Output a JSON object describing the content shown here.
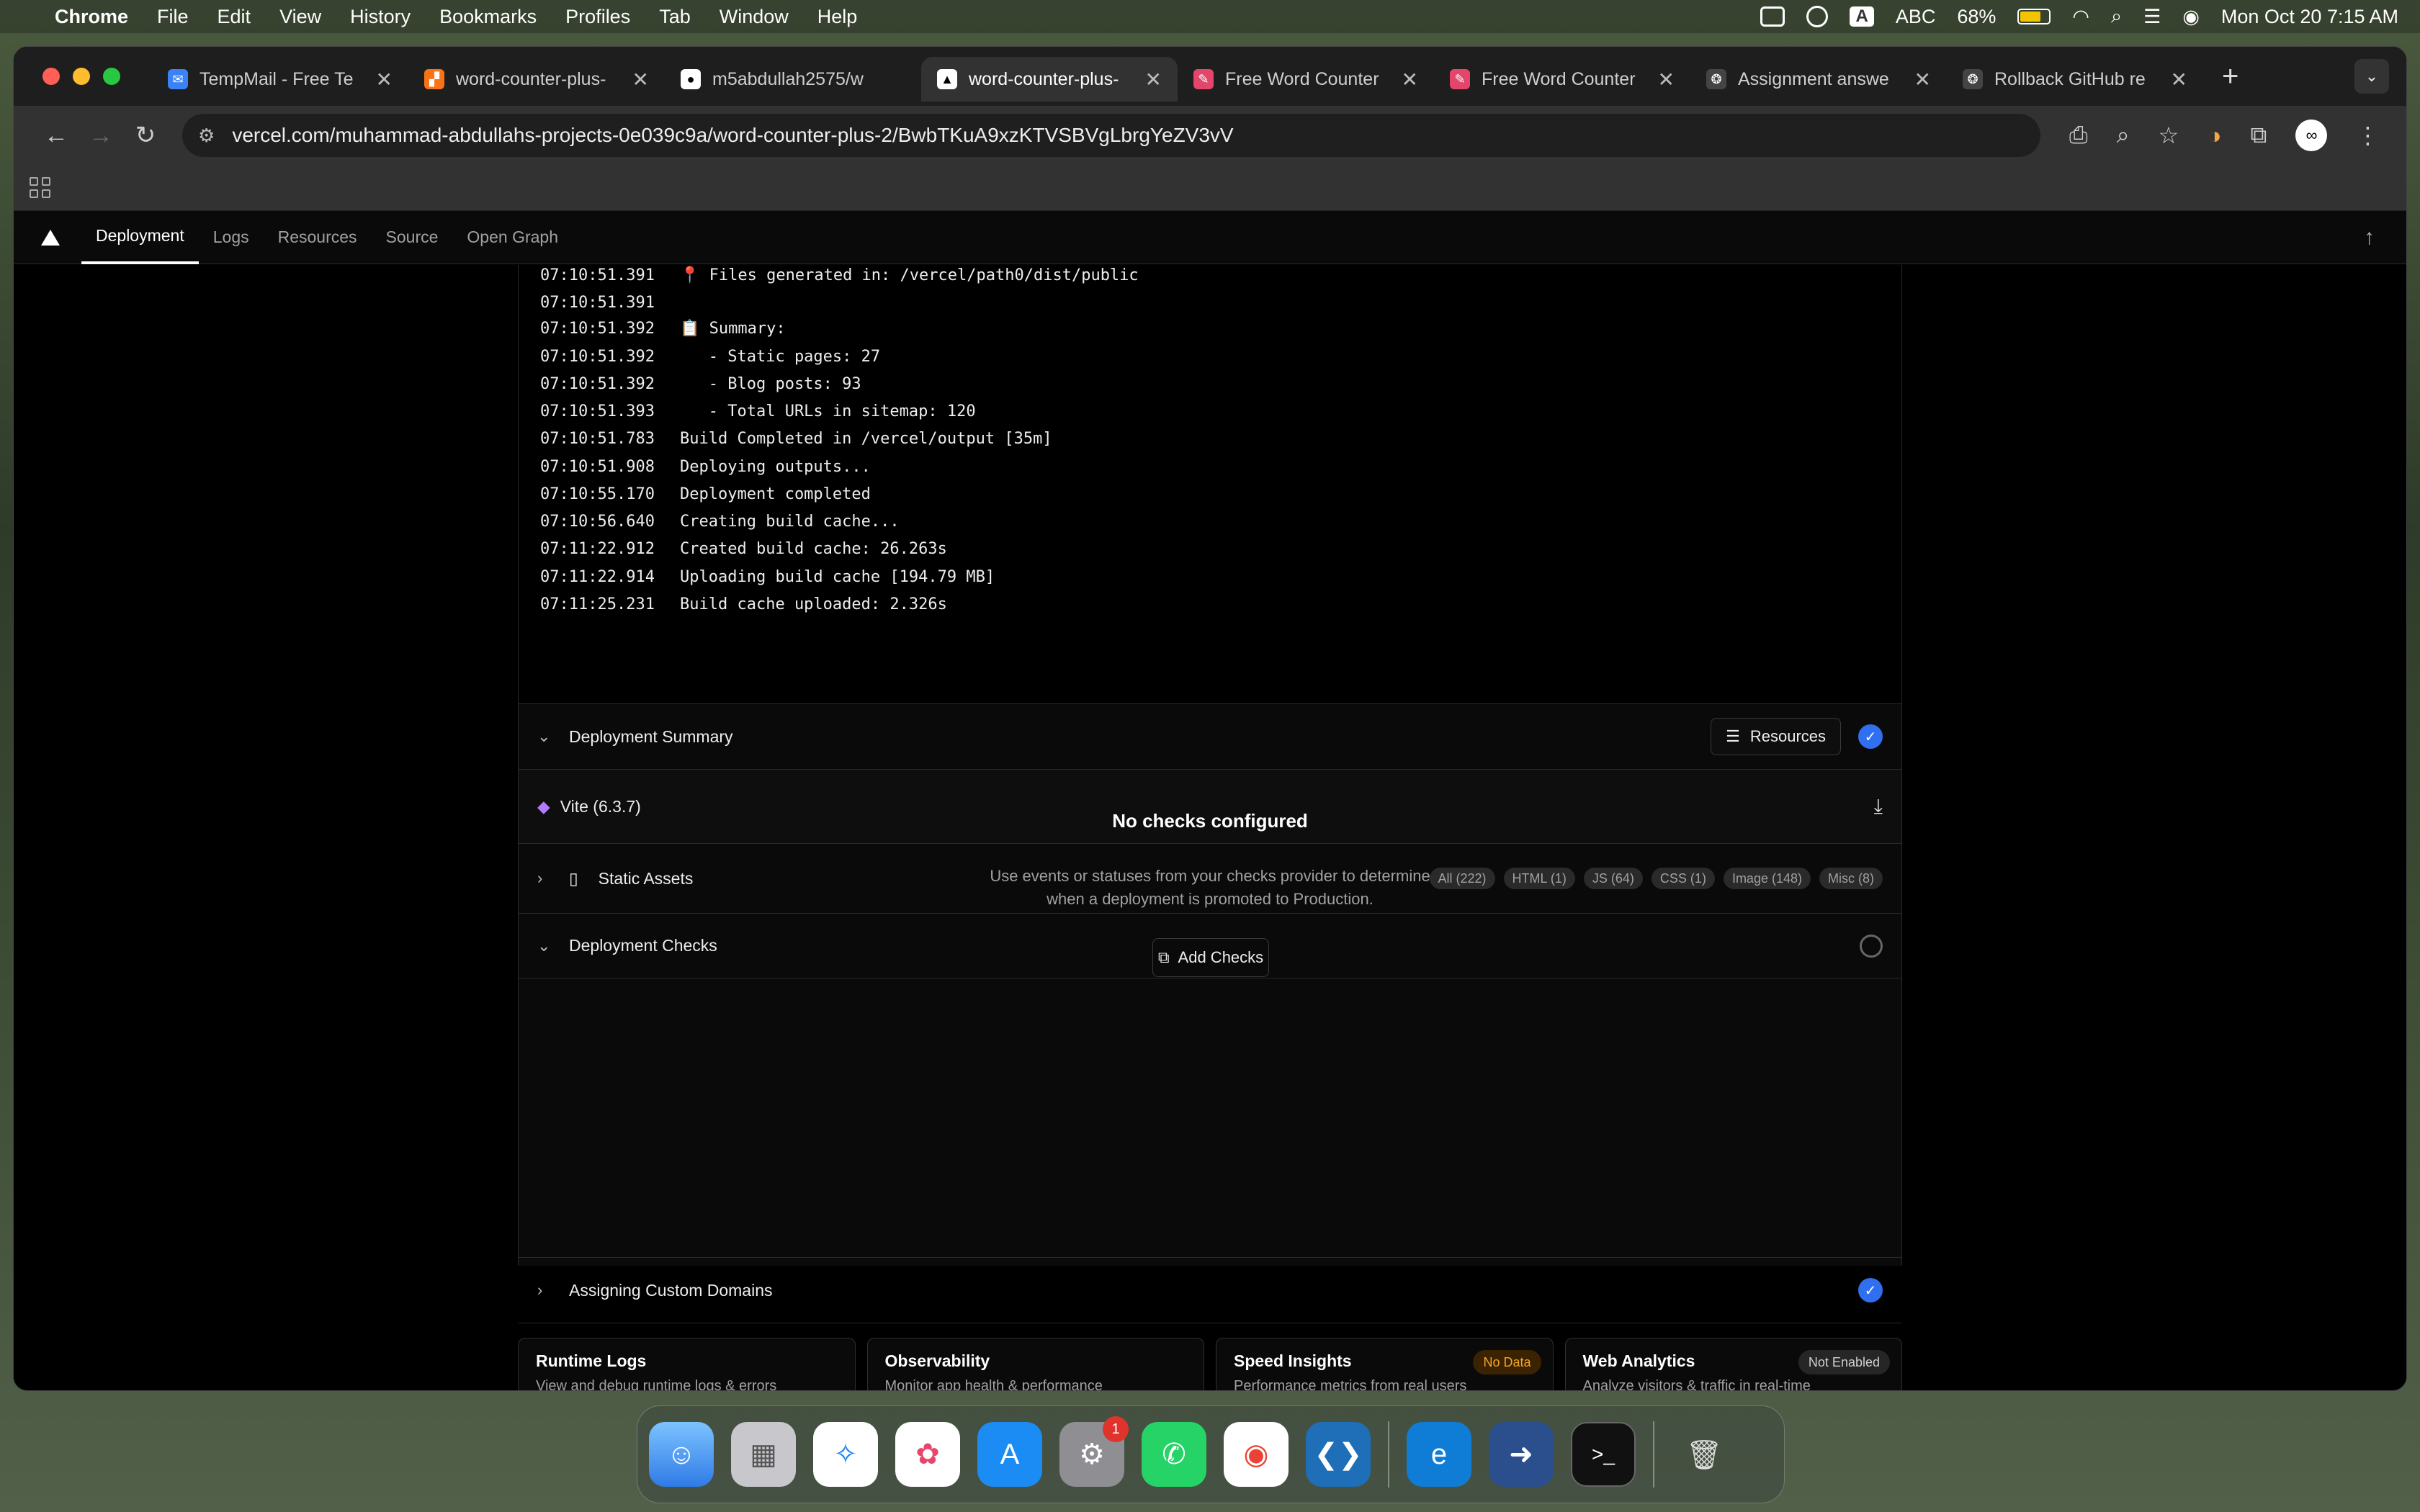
{
  "menubar": {
    "app": "Chrome",
    "items": [
      "File",
      "Edit",
      "View",
      "History",
      "Bookmarks",
      "Profiles",
      "Tab",
      "Window",
      "Help"
    ],
    "input_abc": "ABC",
    "battery": "68%",
    "datetime": "Mon Oct 20  7:15 AM"
  },
  "tabs": [
    {
      "title": "TempMail - Free Te",
      "color": "#3b82f6",
      "glyph": "✉"
    },
    {
      "title": "word-counter-plus-",
      "color": "#f97316",
      "glyph": "▞"
    },
    {
      "title": "m5abdullah2575/w",
      "color": "#111111",
      "glyph": "●"
    },
    {
      "title": "word-counter-plus-",
      "color": "#111111",
      "glyph": "▲"
    },
    {
      "title": "Free Word Counter",
      "color": "#e2466b",
      "glyph": "✎"
    },
    {
      "title": "Free Word Counter",
      "color": "#e2466b",
      "glyph": "✎"
    },
    {
      "title": "Assignment answe",
      "color": "#333333",
      "glyph": "❂"
    },
    {
      "title": "Rollback GitHub re",
      "color": "#333333",
      "glyph": "❂"
    }
  ],
  "address": "vercel.com/muhammad-abdullahs-projects-0e039c9a/word-counter-plus-2/BwbTKuA9xzKTVSBVgLbrgYeZV3vV",
  "vercel_nav": {
    "tabs": [
      "Deployment",
      "Logs",
      "Resources",
      "Source",
      "Open Graph"
    ]
  },
  "logs": [
    {
      "t": "07:10:51.391",
      "m": "📍 Files generated in: /vercel/path0/dist/public"
    },
    {
      "t": "07:10:51.391",
      "m": ""
    },
    {
      "t": "07:10:51.392",
      "m": "📋 Summary:"
    },
    {
      "t": "07:10:51.392",
      "m": "   - Static pages: 27"
    },
    {
      "t": "07:10:51.392",
      "m": "   - Blog posts: 93"
    },
    {
      "t": "07:10:51.393",
      "m": "   - Total URLs in sitemap: 120"
    },
    {
      "t": "07:10:51.783",
      "m": "Build Completed in /vercel/output [35m]"
    },
    {
      "t": "07:10:51.908",
      "m": "Deploying outputs..."
    },
    {
      "t": "07:10:55.170",
      "m": "Deployment completed"
    },
    {
      "t": "07:10:56.640",
      "m": "Creating build cache..."
    },
    {
      "t": "07:11:22.912",
      "m": "Created build cache: 26.263s"
    },
    {
      "t": "07:11:22.914",
      "m": "Uploading build cache [194.79 MB]"
    },
    {
      "t": "07:11:25.231",
      "m": "Build cache uploaded: 2.326s"
    }
  ],
  "summary": {
    "title": "Deployment Summary",
    "resources_label": "Resources",
    "framework": "Vite (6.3.7)",
    "assets_label": "Static Assets",
    "chips": [
      "All (222)",
      "HTML (1)",
      "JS (64)",
      "CSS (1)",
      "Image (148)",
      "Misc (8)"
    ]
  },
  "checks": {
    "title": "Deployment Checks",
    "empty_title": "No checks configured",
    "empty_desc": "Use events or statuses from your checks provider to determine when a deployment is promoted to Production.",
    "add_label": "Add Checks"
  },
  "domains": {
    "title": "Assigning Custom Domains"
  },
  "cards": [
    {
      "title": "Runtime Logs",
      "desc": "View and debug runtime logs & errors",
      "badge": ""
    },
    {
      "title": "Observability",
      "desc": "Monitor app health & performance",
      "badge": ""
    },
    {
      "title": "Speed Insights",
      "desc": "Performance metrics from real users",
      "badge": "No Data"
    },
    {
      "title": "Web Analytics",
      "desc": "Analyze visitors & traffic in real-time",
      "badge": "Not Enabled"
    }
  ],
  "dock": {
    "badge_count": "1"
  },
  "colors": {
    "accent": "#2f6ff0",
    "warning_badge_bg": "#3b2200",
    "warning_badge_fg": "#f5a524"
  }
}
